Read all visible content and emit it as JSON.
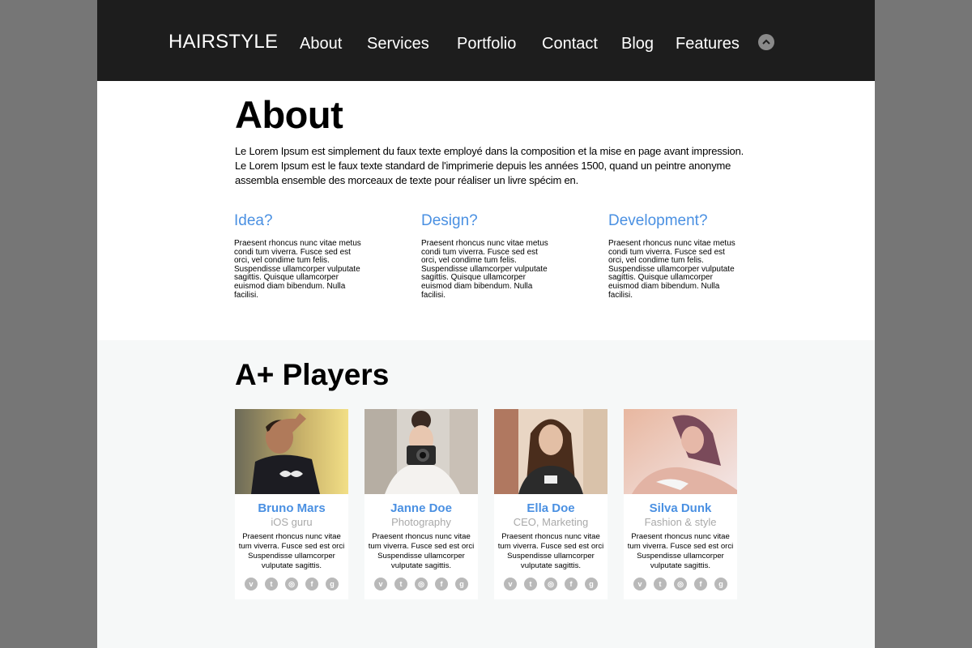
{
  "header": {
    "logo": "HAIRSTYLE",
    "nav": [
      "About",
      "Services",
      "Portfolio",
      "Contact",
      "Blog",
      "Features"
    ],
    "scroll_top_icon": "chevron-up-icon"
  },
  "about": {
    "title": "About",
    "text": "Le Lorem Ipsum est simplement du faux texte employé dans la composition et la mise en page avant impression. Le Lorem Ipsum est le faux texte standard de l'imprimerie depuis les années 1500, quand un peintre anonyme assembla ensemble des morceaux de texte pour réaliser un livre spécim en.",
    "columns": [
      {
        "title": "Idea?",
        "text": "Praesent rhoncus nunc vitae metus condi tum viverra. Fusce sed est orci, vel condime tum felis. Suspendisse ullamcorper vulputate sagittis. Quisque ullamcorper euismod diam bibendum. Nulla facilisi."
      },
      {
        "title": "Design?",
        "text": "Praesent rhoncus nunc vitae metus condi tum viverra. Fusce sed est orci, vel condime tum felis. Suspendisse ullamcorper vulputate sagittis. Quisque ullamcorper euismod diam bibendum. Nulla facilisi."
      },
      {
        "title": "Development?",
        "text": "Praesent rhoncus nunc vitae metus condi tum viverra. Fusce sed est orci, vel condime tum felis. Suspendisse ullamcorper vulputate sagittis. Quisque ullamcorper euismod diam bibendum. Nulla facilisi."
      }
    ]
  },
  "players": {
    "title": "A+ Players",
    "members": [
      {
        "name": "Bruno Mars",
        "role": "iOS guru",
        "text": "Praesent rhoncus nunc vitae tum viverra. Fusce sed est orci Suspendisse ullamcorper vulputate sagittis."
      },
      {
        "name": "Janne Doe",
        "role": "Photography",
        "text": "Praesent rhoncus nunc vitae tum viverra. Fusce sed est orci Suspendisse ullamcorper vulputate sagittis."
      },
      {
        "name": "Ella Doe",
        "role": "CEO, Marketing",
        "text": "Praesent rhoncus nunc vitae tum viverra. Fusce sed est orci Suspendisse ullamcorper vulputate sagittis."
      },
      {
        "name": "Silva Dunk",
        "role": "Fashion & style",
        "text": "Praesent rhoncus nunc vitae tum viverra. Fusce sed est orci Suspendisse ullamcorper vulputate sagittis."
      }
    ],
    "social_icons": [
      "vimeo-icon",
      "twitter-icon",
      "dribbble-icon",
      "facebook-icon",
      "google-plus-icon"
    ]
  },
  "colors": {
    "header_bg": "#1d1d1d",
    "accent": "#4a90e2",
    "outer_bg": "#767676",
    "players_bg": "#f6f8f8"
  }
}
